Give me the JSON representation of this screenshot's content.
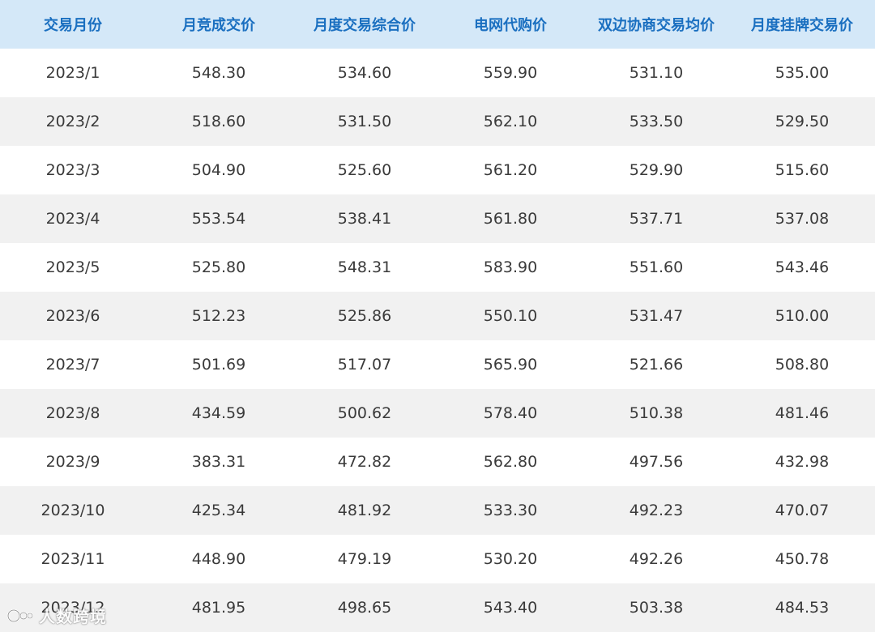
{
  "table": {
    "headers": [
      "交易月份",
      "月竞成交价",
      "月度交易综合价",
      "电网代购价",
      "双边协商交易均价",
      "月度挂牌交易价"
    ],
    "rows": [
      [
        "2023/1",
        "548.30",
        "534.60",
        "559.90",
        "531.10",
        "535.00"
      ],
      [
        "2023/2",
        "518.60",
        "531.50",
        "562.10",
        "533.50",
        "529.50"
      ],
      [
        "2023/3",
        "504.90",
        "525.60",
        "561.20",
        "529.90",
        "515.60"
      ],
      [
        "2023/4",
        "553.54",
        "538.41",
        "561.80",
        "537.71",
        "537.08"
      ],
      [
        "2023/5",
        "525.80",
        "548.31",
        "583.90",
        "551.60",
        "543.46"
      ],
      [
        "2023/6",
        "512.23",
        "525.86",
        "550.10",
        "531.47",
        "510.00"
      ],
      [
        "2023/7",
        "501.69",
        "517.07",
        "565.90",
        "521.66",
        "508.80"
      ],
      [
        "2023/8",
        "434.59",
        "500.62",
        "578.40",
        "510.38",
        "481.46"
      ],
      [
        "2023/9",
        "383.31",
        "472.82",
        "562.80",
        "497.56",
        "432.98"
      ],
      [
        "2023/10",
        "425.34",
        "481.92",
        "533.30",
        "492.23",
        "470.07"
      ],
      [
        "2023/11",
        "448.90",
        "479.19",
        "530.20",
        "492.26",
        "450.78"
      ],
      [
        "2023/12",
        "481.95",
        "498.65",
        "543.40",
        "503.38",
        "484.53"
      ]
    ]
  },
  "watermark": {
    "text": "人数跨境",
    "icon": "watermark-logo-icon"
  },
  "colors": {
    "header_bg": "#d4e8f8",
    "header_text": "#1a6fc0",
    "row_alt_bg": "#f1f1f1",
    "cell_text": "#3a3a3a"
  }
}
